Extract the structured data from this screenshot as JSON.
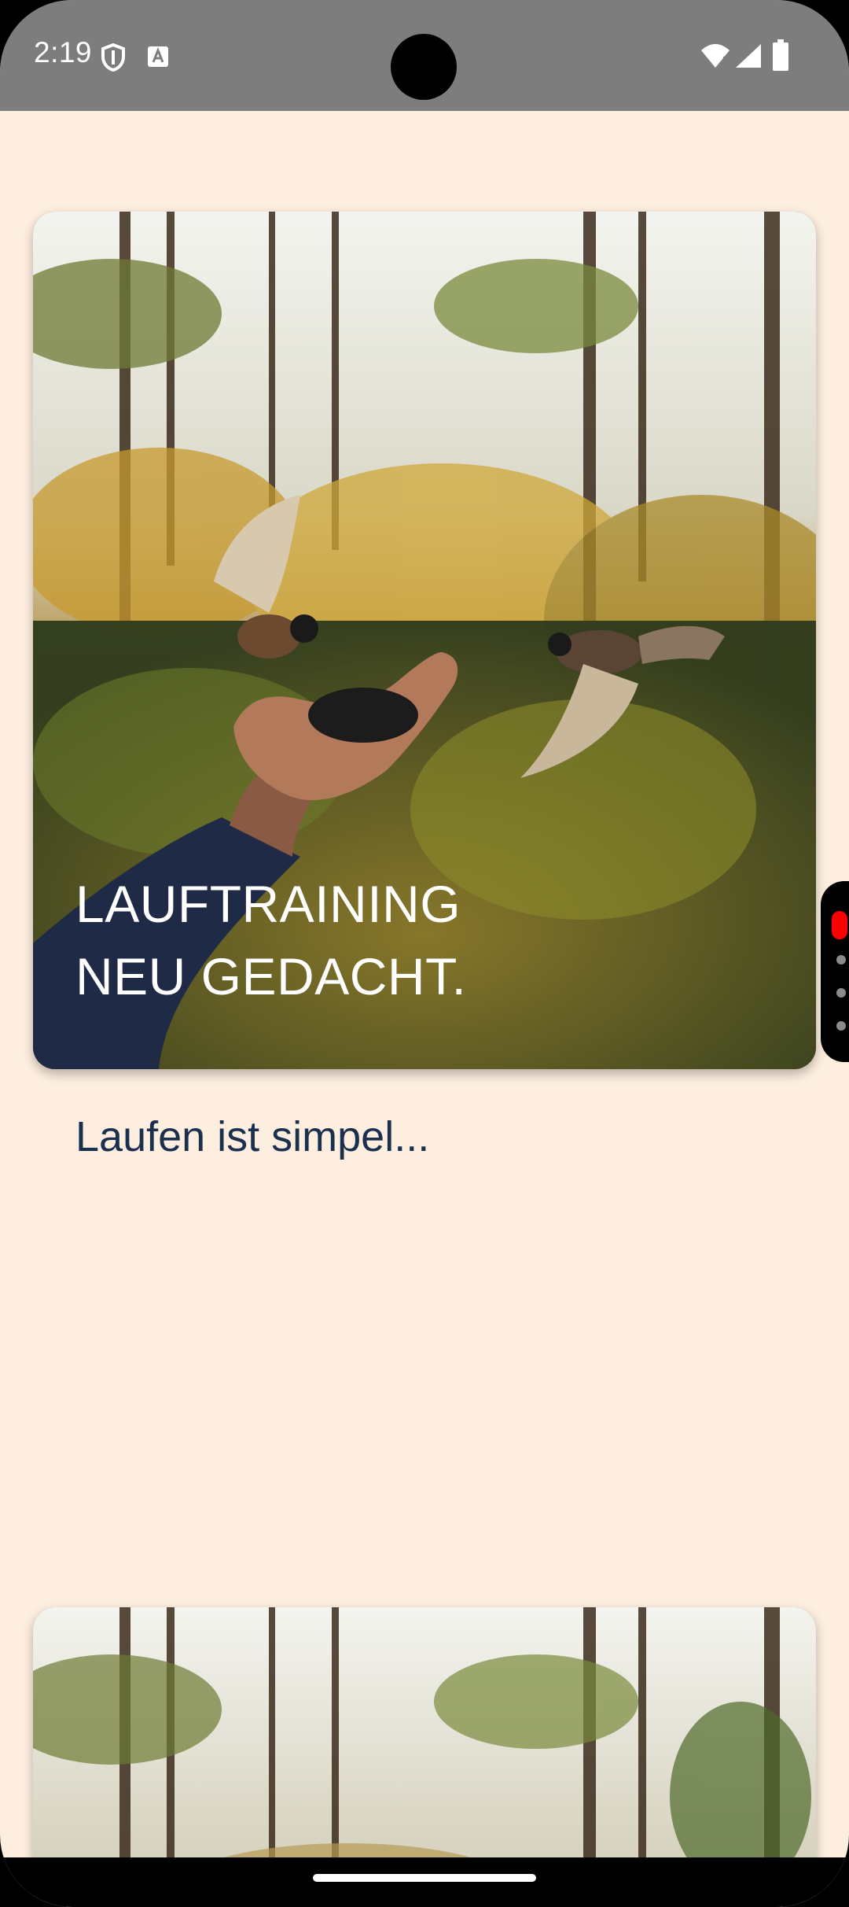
{
  "status_bar": {
    "time": "2:19",
    "icons": [
      "shield-icon",
      "font-a-icon",
      "wifi-icon",
      "signal-icon",
      "battery-icon"
    ]
  },
  "cards": [
    {
      "title": "LAUFTRAINING\nNEU GEDACHT.",
      "image": "forest-hand-feeding-birds-photo"
    },
    {
      "title": "",
      "image": "forest-hand-feeding-birds-photo"
    }
  ],
  "subtitle": "Laufen ist simpel...",
  "colors": {
    "background": "#FDEEDF",
    "status_bar": "#7D7D7D",
    "subtitle_text": "#1B2F4E",
    "title_text": "#FFFFFF"
  }
}
